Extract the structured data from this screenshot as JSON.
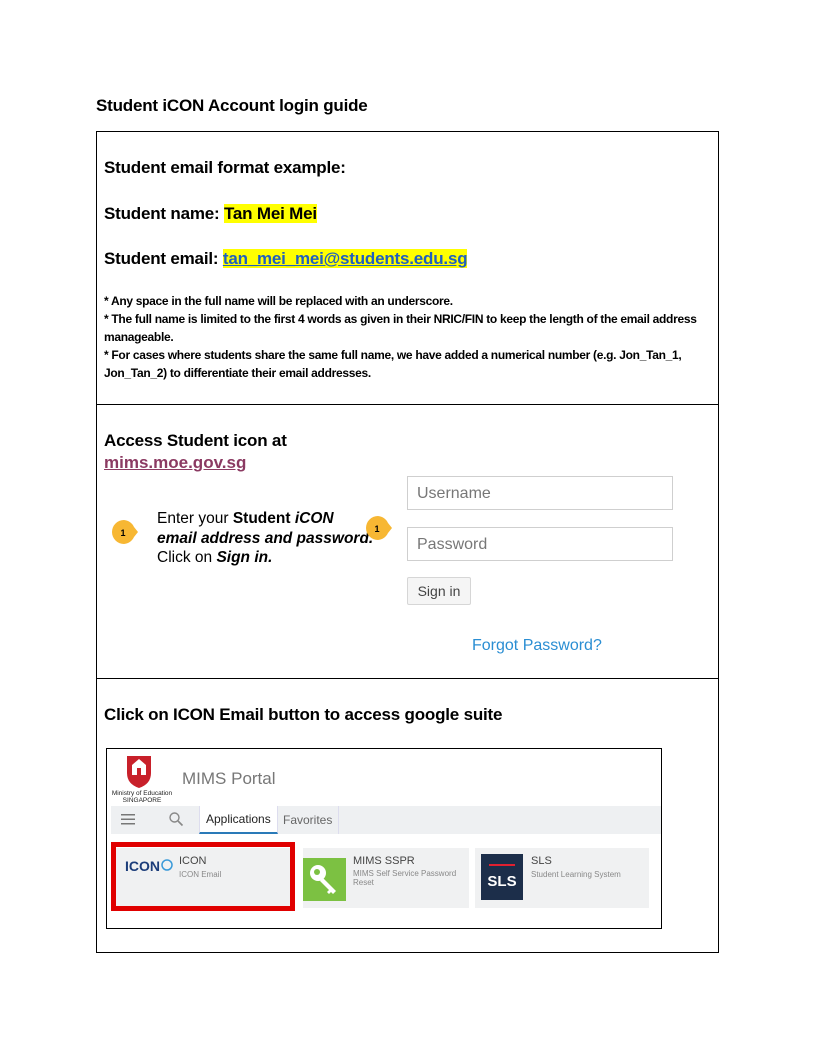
{
  "doc_title": "Student iCON Account login guide",
  "section1": {
    "heading": "Student email format example:",
    "name_label": "Student name: ",
    "name_value": "Tan Mei Mei",
    "email_label": "Student email: ",
    "email_value": "tan_mei_mei@students.edu.sg",
    "notes": [
      "* Any space in the full name will be replaced with an underscore.",
      "* The full name is limited to the first 4 words as given in their NRIC/FIN to keep the length of the email address manageable.",
      "* For cases where students share the same full name, we have added a numerical number (e.g. Jon_Tan_1, Jon_Tan_2) to differentiate their email addresses."
    ]
  },
  "section2": {
    "heading": "Access Student icon at",
    "link": "mims.moe.gov.sg",
    "step_number": "1",
    "instr_1": "Enter your ",
    "instr_2": "Student ",
    "instr_3": "iCON email address and password.",
    "instr_4": " Click on ",
    "instr_5": "Sign in.",
    "username_placeholder": "Username",
    "password_placeholder": "Password",
    "signin_label": "Sign in",
    "forgot_label": "Forgot Password?"
  },
  "section3": {
    "heading": "Click on ICON Email button to access google suite",
    "portal": {
      "moe_line1": "Ministry of Education",
      "moe_line2": "SINGAPORE",
      "title": "MIMS Portal",
      "tab_apps": "Applications",
      "tab_fav": "Favorites",
      "tiles": [
        {
          "logo": "ICON",
          "title": "ICON",
          "sub": "ICON Email"
        },
        {
          "logo": "key-icon",
          "title": "MIMS SSPR",
          "sub": "MIMS Self Service Password Reset"
        },
        {
          "logo": "SLS",
          "title": "SLS",
          "sub": "Student Learning System"
        }
      ]
    }
  },
  "colors": {
    "highlight": "#ffff00",
    "link_blue": "#1f5fbf",
    "mims_link": "#8b3a62",
    "bubble": "#f7b733",
    "forgot": "#2a8ed3",
    "red_frame": "#e00000",
    "sspr_green": "#7cc142",
    "sls_navy": "#1c2e4a"
  }
}
